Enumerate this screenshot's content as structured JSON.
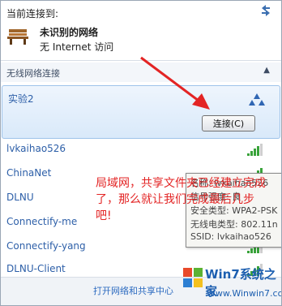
{
  "header": {
    "title": "当前连接到:",
    "refresh_icon": "refresh-arrows-icon",
    "network_icon": "bench-icon",
    "network_name": "未识别的网络",
    "network_status": "无 Internet 访问"
  },
  "section": {
    "label": "无线网络连接",
    "chevron": "▲"
  },
  "selected": {
    "name": "实验2",
    "connect_label": "连接(C)"
  },
  "networks": [
    {
      "name": "lvkaihao526",
      "bars": 4
    },
    {
      "name": "ChinaNet",
      "bars": 5
    },
    {
      "name": "DLNU",
      "bars": 5
    },
    {
      "name": "Connectify-me",
      "bars": 4
    },
    {
      "name": "Connectify-yang",
      "bars": 4
    },
    {
      "name": "DLNU-Client",
      "bars": 4
    }
  ],
  "footer": {
    "link": "打开网络和共享中心"
  },
  "tooltip": {
    "line1": "名称: lvkaihao526",
    "line2": "信号强度: 良",
    "line3": "安全类型: WPA2-PSK",
    "line4": "无线电类型: 802.11n",
    "line5": "SSID: lvkaihao526"
  },
  "annotation": {
    "text": "局域网，共享文件夹已经建立完成了，那么就让我们完成最后几步吧!"
  },
  "watermark": {
    "brand": "Win7系统之家",
    "url": "Www.Winwin7.com"
  },
  "colors": {
    "accent": "#2d5fa8",
    "annotation": "#e32424",
    "signal": "#39a33a"
  }
}
